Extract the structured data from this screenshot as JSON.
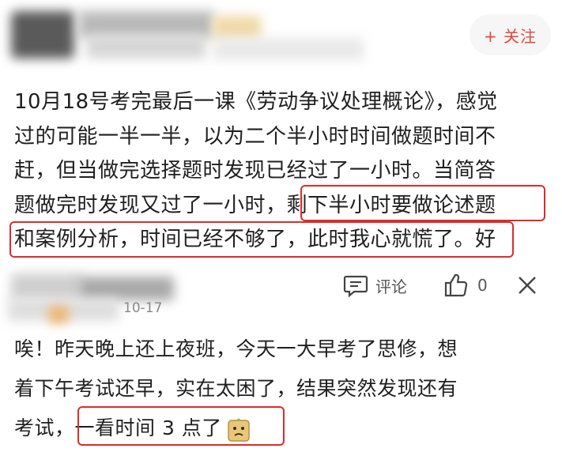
{
  "header": {
    "follow_label": "+ 关注"
  },
  "post": {
    "lines": [
      "10月18号考完最后一课《劳动争议处理概论》，感觉",
      "过的可能一半一半，以为二个半小时时间做题时间不",
      "赶，但当做完选择题时发现已经过了一小时。当简答",
      "题做完时发现又过了一小时，剩下半小时要做论述题",
      "和案例分析，时间已经不够了，此时我心就慌了。好"
    ]
  },
  "actions": {
    "comment_label": "评论",
    "like_count": "0"
  },
  "comment": {
    "date": "10-17",
    "lines": [
      "唉！昨天晚上还上夜班，今天一大早考了思修，想",
      "着下午考试还早，实在太困了，结果突然发现还有",
      "考试，一看时间 3 点了"
    ]
  },
  "colors": {
    "highlight": "#e02a2a",
    "follow": "#e8453c"
  },
  "icons": [
    "comment-icon",
    "thumbs-up-icon",
    "close-icon",
    "emoji-sticker-icon"
  ]
}
